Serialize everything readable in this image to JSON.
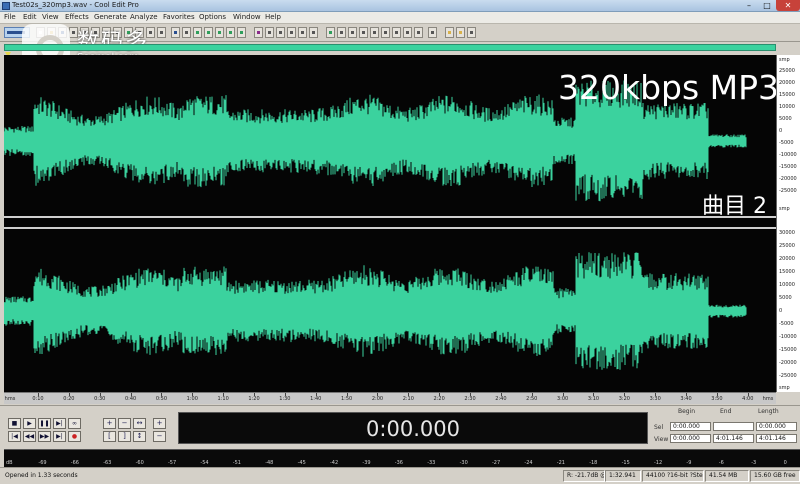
{
  "window": {
    "title": "Test02s_320mp3.wav - Cool Edit Pro"
  },
  "menu": [
    "File",
    "Edit",
    "View",
    "Effects",
    "Generate",
    "Analyze",
    "Favorites",
    "Options",
    "Window",
    "Help"
  ],
  "watermark": {
    "brand": "数码多",
    "site": "Soomal.com"
  },
  "overlay": {
    "format_label": "320kbps MP3",
    "track_label": "曲目 2"
  },
  "amplitude_ruler": {
    "top_channel": [
      "smp",
      "25000",
      "20000",
      "15000",
      "10000",
      "5000",
      "0",
      "-5000",
      "-10000",
      "-15000",
      "-20000",
      "-25000",
      "smp"
    ],
    "bottom_channel": [
      "30000",
      "25000",
      "20000",
      "15000",
      "10000",
      "5000",
      "0",
      "-5000",
      "-10000",
      "-15000",
      "-20000",
      "-25000",
      "smp"
    ]
  },
  "time_ruler": {
    "start": "hms",
    "end": "hms",
    "ticks": [
      "0:10",
      "0:20",
      "0:30",
      "0:40",
      "0:50",
      "1:00",
      "1:10",
      "1:20",
      "1:30",
      "1:40",
      "1:50",
      "2:00",
      "2:10",
      "2:20",
      "2:30",
      "2:40",
      "2:50",
      "3:00",
      "3:10",
      "3:20",
      "3:30",
      "3:40",
      "3:50",
      "4:00"
    ]
  },
  "transport": {
    "current_time": "0:00.000"
  },
  "selection": {
    "headers": [
      "Begin",
      "End",
      "Length"
    ],
    "sel": {
      "label": "Sel",
      "begin": "0:00.000",
      "end": "",
      "length": "0:00.000"
    },
    "view": {
      "label": "View",
      "begin": "0:00.000",
      "end": "4:01.146",
      "length": "4:01.146"
    }
  },
  "level_meter": {
    "ticks": [
      "dB",
      "-69",
      "-66",
      "-63",
      "-60",
      "-57",
      "-54",
      "-51",
      "-48",
      "-45",
      "-42",
      "-39",
      "-36",
      "-33",
      "-30",
      "-27",
      "-24",
      "-21",
      "-18",
      "-15",
      "-12",
      "-9",
      "-6",
      "-3",
      "0"
    ]
  },
  "status": {
    "message": "Opened in 1.33 seconds",
    "level": "R: -21.7dB @",
    "cursor_time": "1:32.941",
    "format": "44100 ?16-bit ?Stereo",
    "file_size": "41.54 MB",
    "free_space": "15.60 GB free"
  },
  "colors": {
    "waveform": "#3bd29e",
    "background": "#050505",
    "overview": "#3bd29e"
  }
}
